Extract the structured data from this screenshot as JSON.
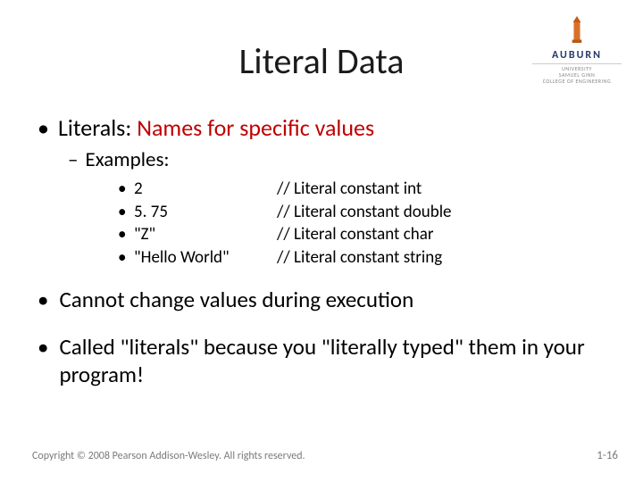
{
  "logo": {
    "word": "AUBURN",
    "sub1": "UNIVERSITY",
    "sub2": "SAMUEL GINN",
    "sub3": "COLLEGE OF ENGINEERING"
  },
  "title": "Literal Data",
  "line1_prefix": "Literals: ",
  "line1_red": "Names for specific values",
  "sub_examples_label": "Examples:",
  "examples": [
    {
      "left": "2",
      "right": "// Literal constant int"
    },
    {
      "left": "5. 75",
      "right": "// Literal constant double"
    },
    {
      "left": "\"Z\"",
      "right": "// Literal constant char"
    },
    {
      "left": "\"Hello World\"",
      "right": "// Literal constant string"
    }
  ],
  "bullet2": "Cannot change values during execution",
  "bullet3": "Called \"literals\" because you \"literally typed\" them in your program!",
  "copyright": "Copyright © 2008 Pearson Addison-Wesley. All rights reserved.",
  "pagenum": "1-16"
}
